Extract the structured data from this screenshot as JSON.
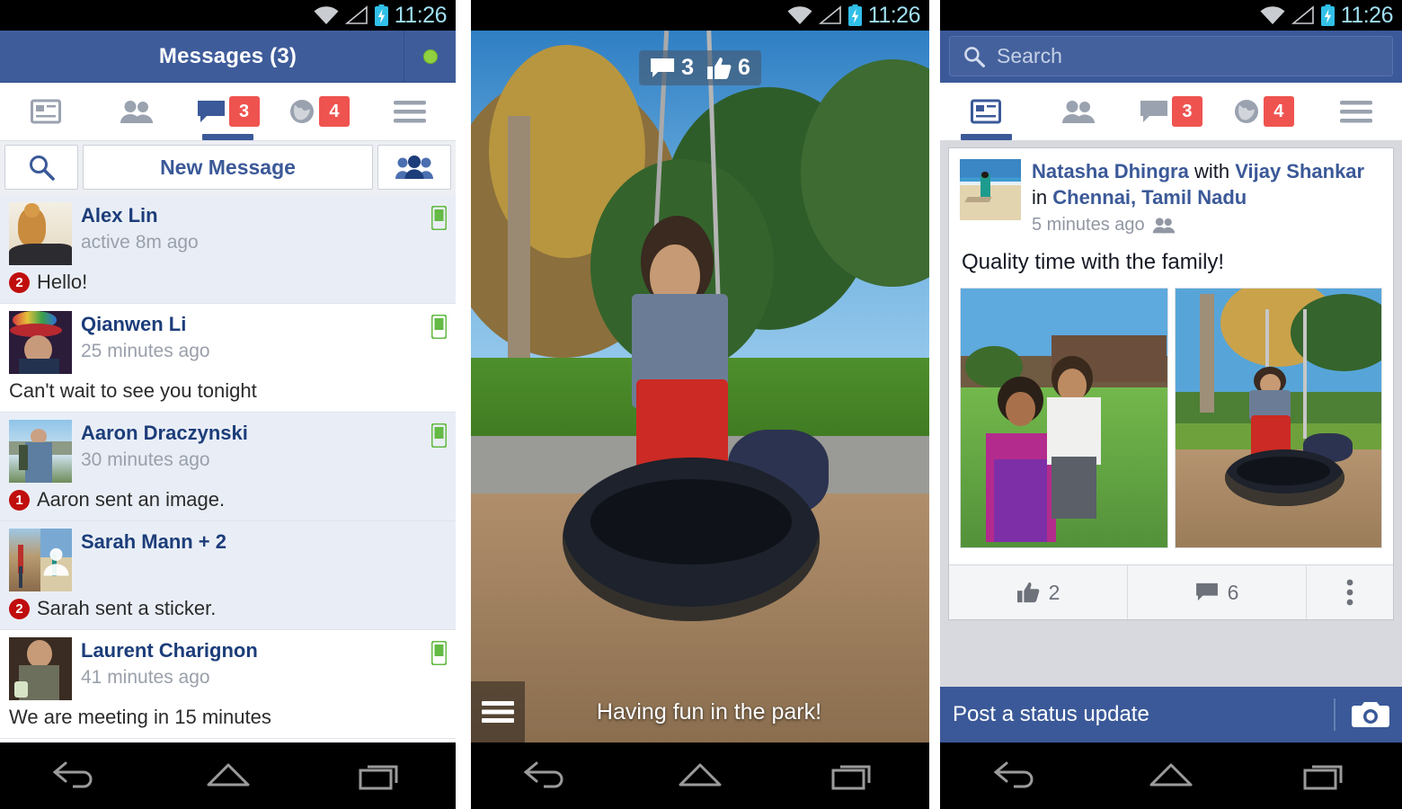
{
  "status_bar": {
    "time": "11:26",
    "icons": [
      "wifi-icon",
      "signal-icon",
      "battery-charging-icon"
    ]
  },
  "android_nav": {
    "back": "back-icon",
    "home": "home-icon",
    "recents": "recents-icon"
  },
  "colors": {
    "fb_blue": "#3b5998",
    "header_blue": "#3f5c9a",
    "badge_red": "#ef5350",
    "unread_red": "#c00d0d",
    "online_green": "#8fd13f",
    "feed_bg": "#d7d9de",
    "link_blue": "#1c3d7a"
  },
  "messenger": {
    "header": {
      "title": "Messages (3)",
      "status_dot": "online-status-dot"
    },
    "tabs": [
      {
        "name": "newsfeed",
        "icon": "newsfeed-icon",
        "badge": "",
        "active": false
      },
      {
        "name": "friends",
        "icon": "friends-icon",
        "badge": "",
        "active": false
      },
      {
        "name": "messages",
        "icon": "messages-icon",
        "badge": "3",
        "active": true
      },
      {
        "name": "notifications",
        "icon": "globe-icon",
        "badge": "4",
        "active": false
      },
      {
        "name": "more",
        "icon": "hamburger-icon",
        "badge": "",
        "active": false
      }
    ],
    "actions": {
      "search_icon": "search-icon",
      "new_message_label": "New Message",
      "group_icon": "group-people-icon"
    },
    "conversations": [
      {
        "name": "Alex Lin",
        "time": "active 8m ago",
        "snippet": "Hello!",
        "unread_count": "2",
        "unread": true,
        "mobile_indicator": true,
        "avatar": "cat-photo"
      },
      {
        "name": "Qianwen  Li",
        "time": "25 minutes ago",
        "snippet": "Can't wait to see you tonight",
        "unread_count": "",
        "unread": false,
        "mobile_indicator": true,
        "avatar": "woman-hat-photo"
      },
      {
        "name": "Aaron Draczynski",
        "time": "30 minutes ago",
        "snippet": "Aaron sent an image.",
        "unread_count": "1",
        "unread": true,
        "mobile_indicator": true,
        "avatar": "hiker-photo"
      },
      {
        "name": "Sarah Mann + 2",
        "time": "",
        "snippet": "Sarah sent a sticker.",
        "unread_count": "2",
        "unread": true,
        "mobile_indicator": false,
        "avatar": "group-photo"
      },
      {
        "name": "Laurent Charignon",
        "time": "41 minutes ago",
        "snippet": "We are meeting in 15 minutes",
        "unread_count": "",
        "unread": false,
        "mobile_indicator": true,
        "avatar": "man-restaurant-photo"
      }
    ]
  },
  "photo_viewer": {
    "comment_count": "3",
    "like_count": "6",
    "caption": "Having fun in the park!",
    "menu_icon": "hamburger-icon",
    "photo": "child-on-tire-swing"
  },
  "newsfeed": {
    "search": {
      "placeholder": "Search",
      "icon": "search-icon"
    },
    "tabs": [
      {
        "name": "newsfeed",
        "icon": "newsfeed-icon",
        "badge": "",
        "active": true
      },
      {
        "name": "friends",
        "icon": "friends-icon",
        "badge": "",
        "active": false
      },
      {
        "name": "messages",
        "icon": "messages-icon",
        "badge": "3",
        "active": false
      },
      {
        "name": "notifications",
        "icon": "globe-icon",
        "badge": "4",
        "active": false
      },
      {
        "name": "more",
        "icon": "hamburger-icon",
        "badge": "",
        "active": false
      }
    ],
    "post": {
      "author": "Natasha Dhingra",
      "with_word": "with",
      "tagged": "Vijay Shankar",
      "in_word": "in",
      "place": "Chennai, Tamil Nadu",
      "time": "5 minutes ago",
      "audience_icon": "friends-audience-icon",
      "message": "Quality time with the family!",
      "photos": [
        "mother-and-toddler-on-lawn",
        "child-on-tire-swing"
      ],
      "like_count": "2",
      "comment_count": "6",
      "more_icon": "kebab-menu-icon"
    },
    "composer": {
      "placeholder": "Post a status update",
      "camera_icon": "camera-icon"
    }
  }
}
